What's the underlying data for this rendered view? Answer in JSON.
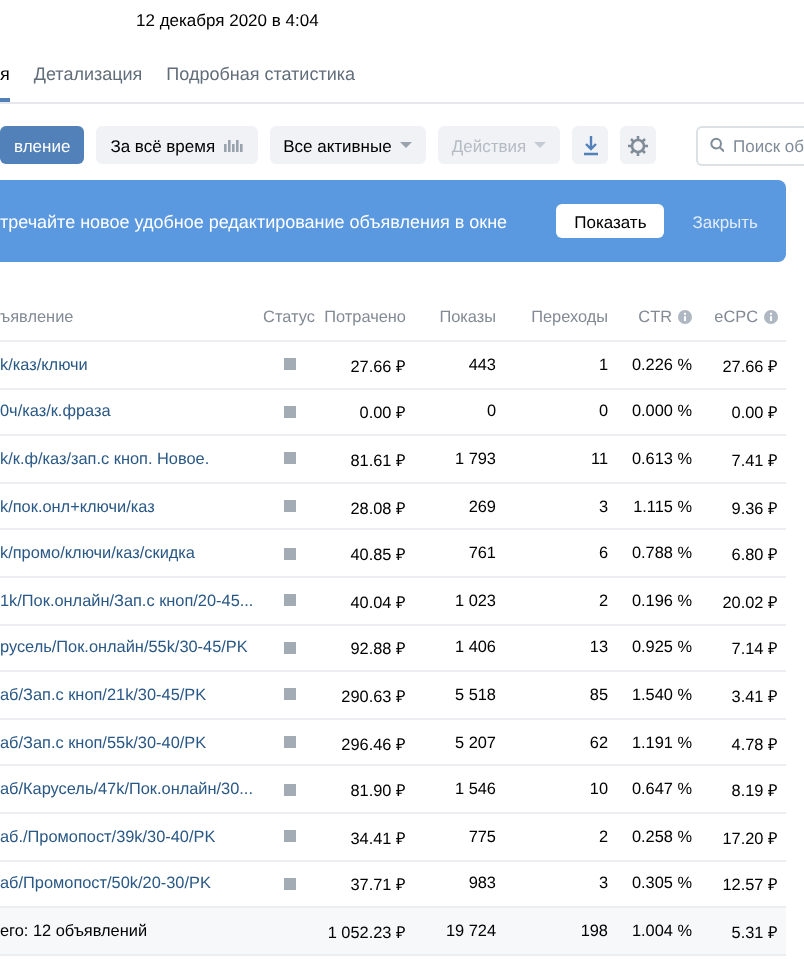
{
  "updated": "12 декабря 2020 в 4:04",
  "tabs": [
    {
      "label": "я",
      "selected": true
    },
    {
      "label": "Детализация",
      "selected": false
    },
    {
      "label": "Подробная статистика",
      "selected": false
    }
  ],
  "toolbar": {
    "create": "вление",
    "period": "За всё время",
    "filter": "Все активные",
    "actions": {
      "label": "Действия",
      "disabled": true
    },
    "search": {
      "placeholder": "Поиск об"
    }
  },
  "banner": {
    "text": "тречайте новое удобное редактирование объявления в окне",
    "show": "Показать",
    "close": "Закрыть"
  },
  "table": {
    "columns": [
      "ъявление",
      "Статус",
      "Потрачено",
      "Показы",
      "Переходы",
      "CTR",
      "eCPC"
    ],
    "rows": [
      [
        "k/каз/ключи",
        "",
        "27.66 ₽",
        "443",
        "1",
        "0.226 %",
        "27.66 ₽"
      ],
      [
        "0ч/каз/к.фраза",
        "",
        "0.00 ₽",
        "0",
        "0",
        "0.000 %",
        "0.00 ₽"
      ],
      [
        "k/к.ф/каз/зап.с кноп. Новое.",
        "",
        "81.61 ₽",
        "1 793",
        "11",
        "0.613 %",
        "7.41 ₽"
      ],
      [
        "k/пок.онл+ключи/каз",
        "",
        "28.08 ₽",
        "269",
        "3",
        "1.115 %",
        "9.36 ₽"
      ],
      [
        "k/промо/ключи/каз/скидка",
        "",
        "40.85 ₽",
        "761",
        "6",
        "0.788 %",
        "6.80 ₽"
      ],
      [
        "1k/Пок.онлайн/Зап.с кноп/20-45...",
        "",
        "40.04 ₽",
        "1 023",
        "2",
        "0.196 %",
        "20.02 ₽"
      ],
      [
        "русель/Пок.онлайн/55k/30-45/PK",
        "",
        "92.88 ₽",
        "1 406",
        "13",
        "0.925 %",
        "7.14 ₽"
      ],
      [
        "аб/Зап.с кноп/21k/30-45/PK",
        "",
        "290.63 ₽",
        "5 518",
        "85",
        "1.540 %",
        "3.41 ₽"
      ],
      [
        "аб/Зап.с кноп/55k/30-40/PK",
        "",
        "296.46 ₽",
        "5 207",
        "62",
        "1.191 %",
        "4.78 ₽"
      ],
      [
        "аб/Карусель/47k/Пок.онлайн/30...",
        "",
        "81.90 ₽",
        "1 546",
        "10",
        "0.647 %",
        "8.19 ₽"
      ],
      [
        "аб./Промопост/39k/30-40/PK",
        "",
        "34.41 ₽",
        "775",
        "2",
        "0.258 %",
        "17.20 ₽"
      ],
      [
        "аб/Промопост/50k/20-30/PK",
        "",
        "37.71 ₽",
        "983",
        "3",
        "0.305 %",
        "12.57 ₽"
      ],
      [
        "его: 12 объявлений",
        "",
        "1 052.23 ₽",
        "19 724",
        "198",
        "1.004 %",
        "5.31 ₽"
      ]
    ]
  }
}
